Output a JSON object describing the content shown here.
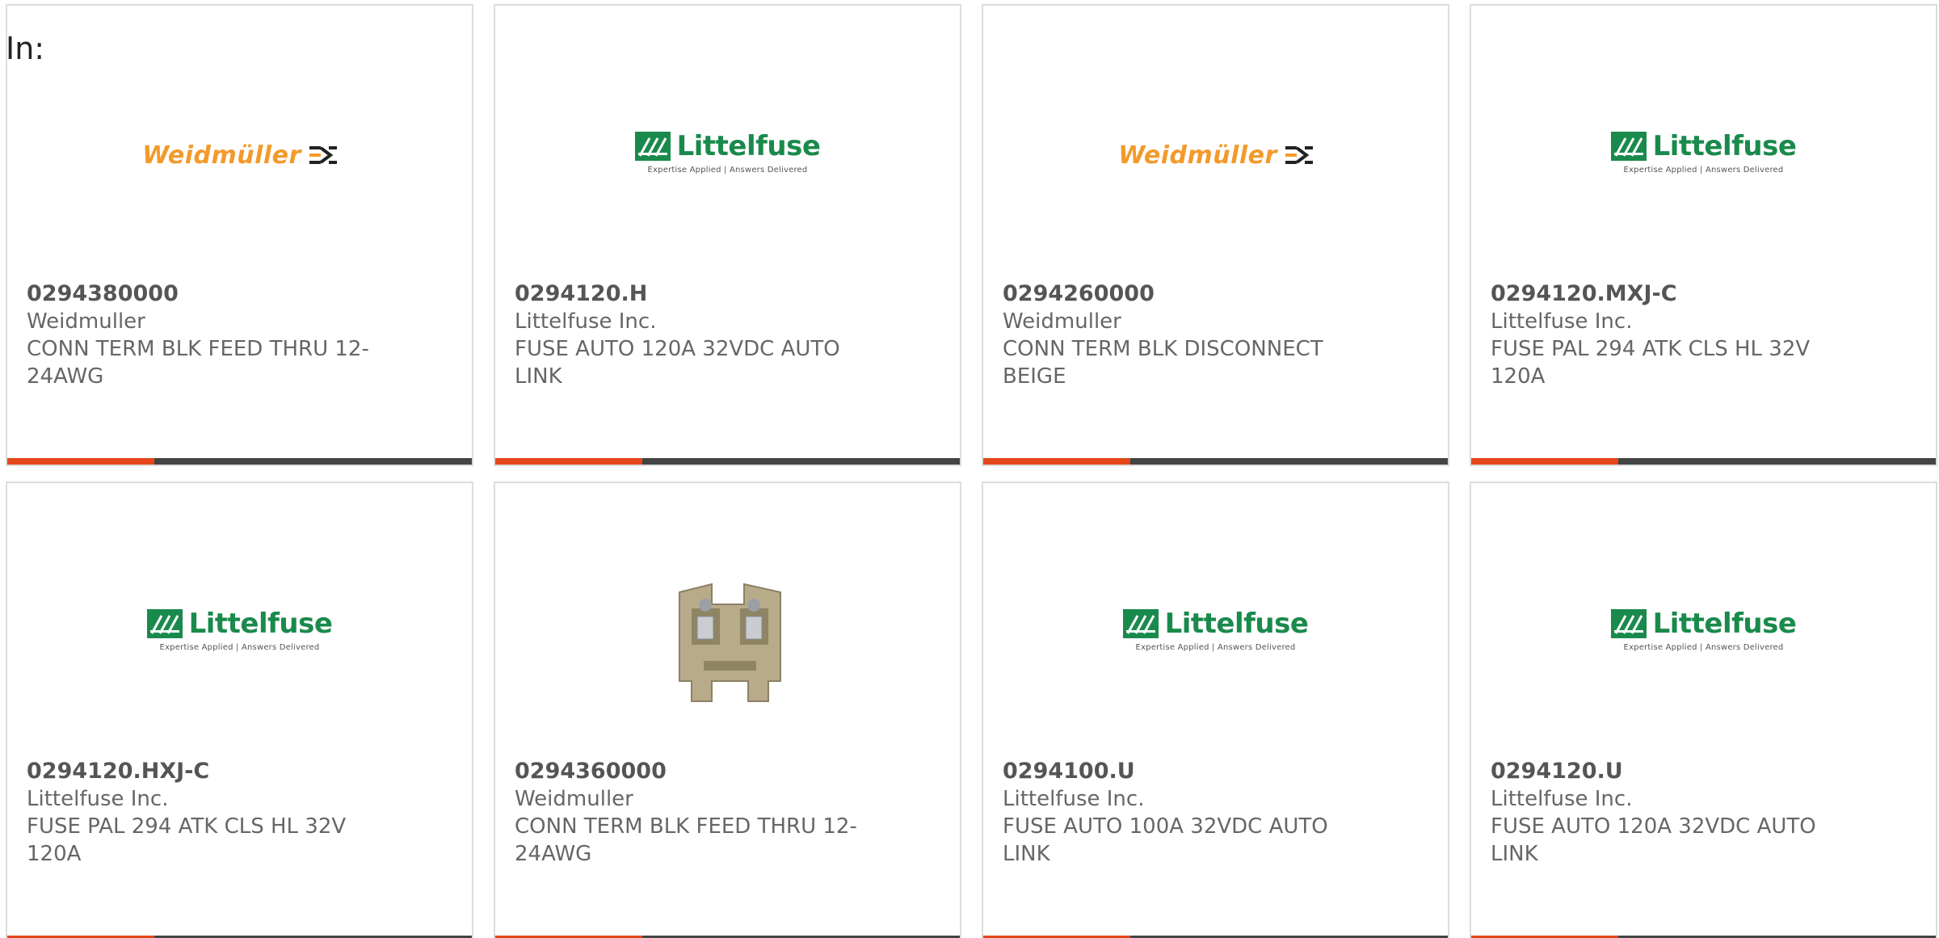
{
  "header": {
    "in_label": "In:"
  },
  "colors": {
    "card_border": "#dcdcdc",
    "bar_dark": "#444444",
    "bar_accent": "#e4471b",
    "weidmuller_orange": "#f39a2b",
    "littelfuse_green": "#1a8a4c"
  },
  "logos": {
    "weidmuller": "Weidmüller",
    "littelfuse": "Littelfuse",
    "littelfuse_tagline": "Expertise Applied | Answers Delivered"
  },
  "products": [
    {
      "part_number": "0294380000",
      "manufacturer": "Weidmuller",
      "description_line1": "CONN TERM BLK FEED THRU 12-",
      "description_line2": "24AWG",
      "image": "weidmuller-logo"
    },
    {
      "part_number": "0294120.H",
      "manufacturer": "Littelfuse Inc.",
      "description_line1": "FUSE AUTO 120A 32VDC AUTO",
      "description_line2": "LINK",
      "image": "littelfuse-logo"
    },
    {
      "part_number": "0294260000",
      "manufacturer": "Weidmuller",
      "description_line1": "CONN TERM BLK DISCONNECT",
      "description_line2": "BEIGE",
      "image": "weidmuller-logo"
    },
    {
      "part_number": "0294120.MXJ-C",
      "manufacturer": "Littelfuse Inc.",
      "description_line1": "FUSE PAL 294 ATK CLS HL 32V",
      "description_line2": "120A",
      "image": "littelfuse-logo"
    },
    {
      "part_number": "0294120.HXJ-C",
      "manufacturer": "Littelfuse Inc.",
      "description_line1": "FUSE PAL 294 ATK CLS HL 32V",
      "description_line2": "120A",
      "image": "littelfuse-logo"
    },
    {
      "part_number": "0294360000",
      "manufacturer": "Weidmuller",
      "description_line1": "CONN TERM BLK FEED THRU 12-",
      "description_line2": "24AWG",
      "image": "terminal-block-photo"
    },
    {
      "part_number": "0294100.U",
      "manufacturer": "Littelfuse Inc.",
      "description_line1": "FUSE AUTO 100A 32VDC AUTO",
      "description_line2": "LINK",
      "image": "littelfuse-logo"
    },
    {
      "part_number": "0294120.U",
      "manufacturer": "Littelfuse Inc.",
      "description_line1": "FUSE AUTO 120A 32VDC AUTO",
      "description_line2": "LINK",
      "image": "littelfuse-logo"
    }
  ]
}
